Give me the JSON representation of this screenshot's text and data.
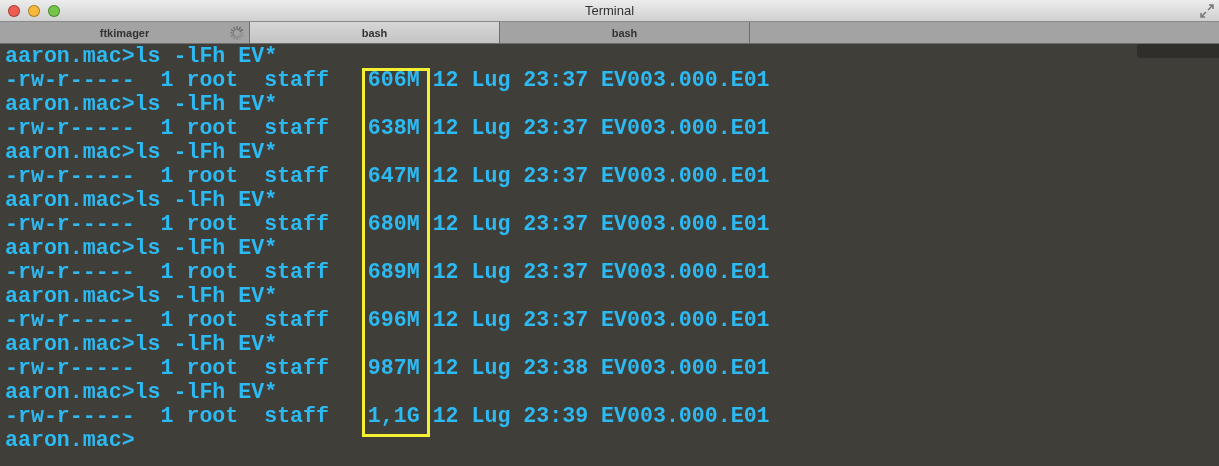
{
  "window": {
    "title": "Terminal"
  },
  "tabs": [
    {
      "label": "ftkimager",
      "selected": false,
      "busy": true
    },
    {
      "label": "bash",
      "selected": true,
      "busy": false
    },
    {
      "label": "bash",
      "selected": false,
      "busy": false
    }
  ],
  "terminal": {
    "lines": [
      "aaron.mac>ls -lFh EV*",
      "-rw-r-----  1 root  staff   606M 12 Lug 23:37 EV003.000.E01",
      "aaron.mac>ls -lFh EV*",
      "-rw-r-----  1 root  staff   638M 12 Lug 23:37 EV003.000.E01",
      "aaron.mac>ls -lFh EV*",
      "-rw-r-----  1 root  staff   647M 12 Lug 23:37 EV003.000.E01",
      "aaron.mac>ls -lFh EV*",
      "-rw-r-----  1 root  staff   680M 12 Lug 23:37 EV003.000.E01",
      "aaron.mac>ls -lFh EV*",
      "-rw-r-----  1 root  staff   689M 12 Lug 23:37 EV003.000.E01",
      "aaron.mac>ls -lFh EV*",
      "-rw-r-----  1 root  staff   696M 12 Lug 23:37 EV003.000.E01",
      "aaron.mac>ls -lFh EV*",
      "-rw-r-----  1 root  staff   987M 12 Lug 23:38 EV003.000.E01",
      "aaron.mac>ls -lFh EV*",
      "-rw-r-----  1 root  staff   1,1G 12 Lug 23:39 EV003.000.E01",
      "aaron.mac>"
    ]
  }
}
